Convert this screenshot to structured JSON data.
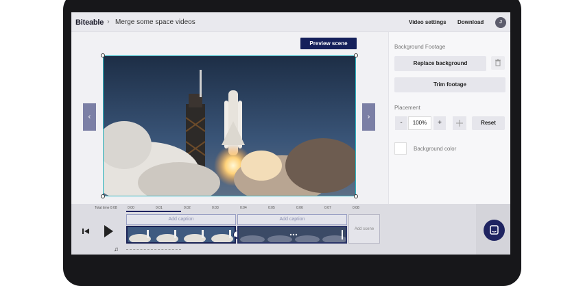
{
  "header": {
    "brand": "Biteable",
    "separator": "›",
    "project_title": "Merge some space videos",
    "video_settings_label": "Video settings",
    "download_label": "Download",
    "avatar_initial": "J"
  },
  "canvas": {
    "preview_label": "Preview scene",
    "prev_arrow": "‹",
    "next_arrow": "›",
    "scene_image": "space shuttle launch footage"
  },
  "panel": {
    "background_footage_title": "Background Footage",
    "replace_background_label": "Replace background",
    "trim_footage_label": "Trim footage",
    "placement_title": "Placement",
    "minus_label": "-",
    "zoom_value": "100%",
    "plus_label": "+",
    "reset_label": "Reset",
    "background_color_label": "Background color",
    "background_color": "#ffffff"
  },
  "timeline": {
    "total_time": "Total time 0:08",
    "ticks": [
      "0:00",
      "0:01",
      "0:02",
      "0:03",
      "0:04",
      "0:05",
      "0:06",
      "0:07",
      "0:08"
    ],
    "caption_placeholder_1": "Add caption",
    "caption_placeholder_2": "Add caption",
    "add_scene_label": "Add scene",
    "music_icon": "♫"
  },
  "colors": {
    "accent_navy": "#15205b",
    "selection_teal": "#2fb6c2",
    "nav_arrow": "#7b7fa5"
  }
}
